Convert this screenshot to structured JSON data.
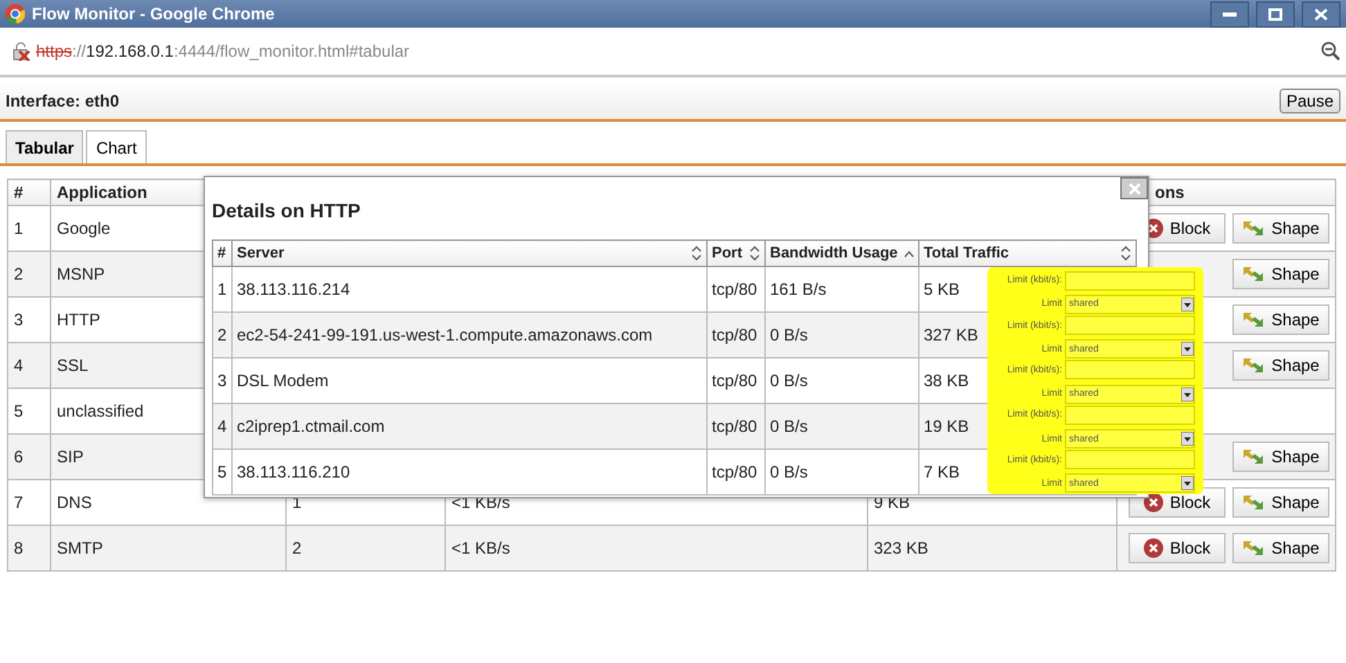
{
  "window": {
    "title": "Flow Monitor - Google Chrome"
  },
  "address": {
    "scheme": "https",
    "separator": "://",
    "host": "192.168.0.1",
    "path": ":4444/flow_monitor.html#tabular"
  },
  "interface": {
    "label": "Interface: eth0",
    "button": "Pause"
  },
  "tabs": [
    {
      "label": "Tabular",
      "selected": true
    },
    {
      "label": "Chart",
      "selected": false
    }
  ],
  "table": {
    "columns": [
      "#",
      "Application"
    ],
    "actions_heading": "ons",
    "rows": [
      {
        "cells": [
          "1",
          "Google"
        ],
        "actions": [
          {
            "kind": "block",
            "label": "Block"
          },
          {
            "kind": "shape",
            "label": "Shape"
          }
        ]
      },
      {
        "cells": [
          "2",
          "MSNP"
        ],
        "actions": [
          {
            "kind": "shape",
            "label": "Shape"
          }
        ]
      },
      {
        "cells": [
          "3",
          "HTTP"
        ],
        "actions": [
          {
            "kind": "shape",
            "label": "Shape"
          }
        ]
      },
      {
        "cells": [
          "4",
          "SSL"
        ],
        "actions": [
          {
            "kind": "shape",
            "label": "Shape"
          }
        ]
      },
      {
        "cells": [
          "5",
          "unclassified"
        ],
        "actions": []
      },
      {
        "cells": [
          "6",
          "SIP"
        ],
        "actions": [
          {
            "kind": "shape",
            "label": "Shape"
          }
        ]
      },
      {
        "cells": [
          "7",
          "DNS",
          "1",
          "<1 KB/s",
          "9 KB"
        ],
        "actions": [
          {
            "kind": "block",
            "label": "Block"
          },
          {
            "kind": "shape",
            "label": "Shape"
          }
        ]
      },
      {
        "cells": [
          "8",
          "SMTP",
          "2",
          "<1 KB/s",
          "323 KB"
        ],
        "actions": [
          {
            "kind": "block",
            "label": "Block"
          },
          {
            "kind": "shape",
            "label": "Shape"
          }
        ]
      }
    ]
  },
  "dialog": {
    "title": "Details on HTTP",
    "columns": [
      {
        "label": "#"
      },
      {
        "label": "Server",
        "sorted": false
      },
      {
        "label": "Port",
        "sorted": false
      },
      {
        "label": "Bandwidth Usage",
        "sorted": true
      },
      {
        "label": "Total Traffic",
        "sorted": false
      }
    ],
    "rows": [
      [
        "1",
        "38.113.116.214",
        "tcp/80",
        "161 B/s",
        "5 KB"
      ],
      [
        "2",
        "ec2-54-241-99-191.us-west-1.compute.amazonaws.com",
        "tcp/80",
        "0 B/s",
        "327 KB"
      ],
      [
        "3",
        "DSL Modem",
        "tcp/80",
        "0 B/s",
        "38 KB"
      ],
      [
        "4",
        "c2iprep1.ctmail.com",
        "tcp/80",
        "0 B/s",
        "19 KB"
      ],
      [
        "5",
        "38.113.116.210",
        "tcp/80",
        "0 B/s",
        "7 KB"
      ]
    ]
  },
  "limits": [
    {
      "rate_label": "Limit (kbit/s):",
      "mode_label": "Limit",
      "mode": "shared"
    },
    {
      "rate_label": "Limit (kbit/s):",
      "mode_label": "Limit",
      "mode": "shared"
    },
    {
      "rate_label": "Limit (kbit/s):",
      "mode_label": "Limit",
      "mode": "shared"
    },
    {
      "rate_label": "Limit (kbit/s):",
      "mode_label": "Limit",
      "mode": "shared"
    },
    {
      "rate_label": "Limit (kbit/s):",
      "mode_label": "Limit",
      "mode": "shared"
    }
  ]
}
